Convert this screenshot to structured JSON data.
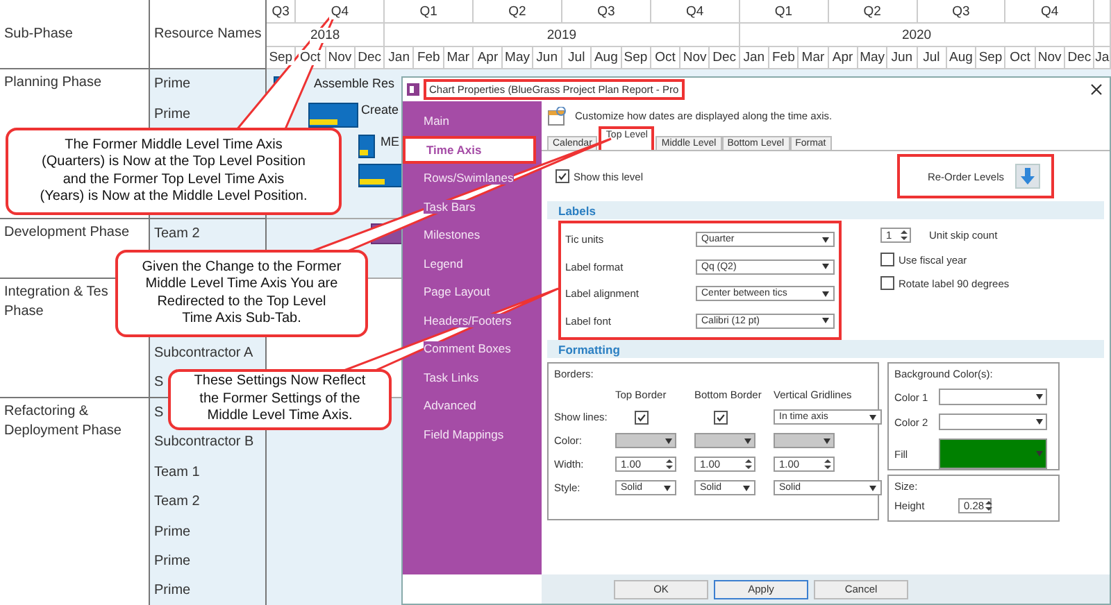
{
  "gantt": {
    "columns": [
      "Sub-Phase",
      "Resource Names"
    ],
    "quarters": [
      "Q3",
      "Q4",
      "Q1",
      "Q2",
      "Q3",
      "Q4",
      "Q1",
      "Q2",
      "Q3",
      "Q4"
    ],
    "years": [
      "2018",
      "2019",
      "2020"
    ],
    "months": [
      "Sep",
      "Oct",
      "Nov",
      "Dec",
      "Jan",
      "Feb",
      "Mar",
      "Apr",
      "May",
      "Jun",
      "Jul",
      "Aug",
      "Sep",
      "Oct",
      "Nov",
      "Dec",
      "Jan",
      "Feb",
      "Mar",
      "Apr",
      "May",
      "Jun",
      "Jul",
      "Aug",
      "Sep",
      "Oct",
      "Nov",
      "Dec",
      "Ja"
    ],
    "phases": [
      {
        "name": [
          "Planning Phase"
        ],
        "shaded": true,
        "resources": [
          "Prime",
          "Prime"
        ],
        "bars": [
          {
            "kind": "task",
            "label": "Assemble Res"
          },
          {
            "kind": "task",
            "label": "Create"
          },
          {
            "kind": "task",
            "label": "ME"
          },
          {
            "kind": "task"
          }
        ]
      },
      {
        "name": [
          "Development Phase"
        ],
        "shaded": true,
        "resources": [
          "Team 2"
        ],
        "bars": [
          {
            "kind": "summary"
          }
        ]
      },
      {
        "name": [
          "Integration & Tes",
          "Phase"
        ],
        "shaded": false,
        "resources": [
          "Subcontractor A",
          "S"
        ]
      },
      {
        "name": [
          "Refactoring &",
          "Deployment Phase"
        ],
        "shaded": true,
        "resources": [
          "S",
          "Subcontractor B",
          "Team 1",
          "Team 2",
          "Prime",
          "Prime",
          "Prime"
        ]
      }
    ]
  },
  "dialog": {
    "title": "Chart Properties (BlueGrass Project Plan Report - Pro",
    "title_highlighted": true,
    "nav": [
      {
        "label": "Main",
        "selected": false
      },
      {
        "label": "Time Axis",
        "selected": true
      },
      {
        "label": "Rows/Swimlanes",
        "selected": false
      },
      {
        "label": "Task Bars",
        "selected": false
      },
      {
        "label": "Milestones",
        "selected": false
      },
      {
        "label": "Legend",
        "selected": false
      },
      {
        "label": "Page Layout",
        "selected": false
      },
      {
        "label": "Headers/Footers",
        "selected": false
      },
      {
        "label": "Comment Boxes",
        "selected": false
      },
      {
        "label": "Task Links",
        "selected": false
      },
      {
        "label": "Advanced",
        "selected": false
      },
      {
        "label": "Field Mappings",
        "selected": false
      }
    ],
    "description": "Customize how dates are displayed along the time axis.",
    "tabs": [
      {
        "label": "Calendar",
        "selected": false,
        "highlighted": false
      },
      {
        "label": "Top Level",
        "selected": true,
        "highlighted": true
      },
      {
        "label": "Middle Level",
        "selected": false,
        "highlighted": false
      },
      {
        "label": "Bottom Level",
        "selected": false,
        "highlighted": false
      },
      {
        "label": "Format",
        "selected": false,
        "highlighted": false
      }
    ],
    "show_level": {
      "label": "Show this level",
      "checked": true
    },
    "reorder": {
      "label": "Re-Order Levels",
      "highlighted": true
    },
    "labels": {
      "title": "Labels",
      "highlighted": true,
      "fields": [
        {
          "label": "Tic units",
          "value": "Quarter"
        },
        {
          "label": "Label format",
          "value": "Qq (Q2)"
        },
        {
          "label": "Label alignment",
          "value": "Center between tics"
        },
        {
          "label": "Label font",
          "value": "Calibri (12 pt)"
        }
      ]
    },
    "unit_skip": {
      "value": "1",
      "label": "Unit skip count"
    },
    "options": [
      {
        "label": "Use fiscal year",
        "checked": false
      },
      {
        "label": "Rotate label 90 degrees",
        "checked": false
      }
    ],
    "formatting": {
      "title": "Formatting",
      "borders_title": "Borders:",
      "columns": [
        "Top Border",
        "Bottom Border",
        "Vertical Gridlines"
      ],
      "rows": [
        {
          "label": "Show lines:",
          "cells": [
            {
              "kind": "checkbox",
              "checked": true
            },
            {
              "kind": "checkbox",
              "checked": true
            },
            {
              "kind": "dropdown",
              "value": "In time axis"
            }
          ]
        },
        {
          "label": "Color:",
          "cells": [
            {
              "kind": "color"
            },
            {
              "kind": "color"
            },
            {
              "kind": "color"
            }
          ]
        },
        {
          "label": "Width:",
          "cells": [
            {
              "kind": "spinner",
              "value": "1.00"
            },
            {
              "kind": "spinner",
              "value": "1.00"
            },
            {
              "kind": "spinner",
              "value": "1.00"
            }
          ]
        },
        {
          "label": "Style:",
          "cells": [
            {
              "kind": "dropdown",
              "value": "Solid"
            },
            {
              "kind": "dropdown",
              "value": "Solid"
            },
            {
              "kind": "dropdown",
              "value": "Solid"
            }
          ]
        }
      ]
    },
    "background": {
      "title": "Background Color(s):",
      "items": [
        {
          "label": "Color 1"
        },
        {
          "label": "Color 2"
        },
        {
          "label": "Fill",
          "color": "#008000"
        }
      ]
    },
    "size": {
      "title": "Size:",
      "label": "Height",
      "value": "0.28"
    },
    "buttons": [
      {
        "label": "OK",
        "focused": false
      },
      {
        "label": "Apply",
        "focused": true
      },
      {
        "label": "Cancel",
        "focused": false
      }
    ]
  },
  "callouts": [
    {
      "text": "The Former Middle Level Time Axis\n(Quarters) is Now at the Top Level Position\nand the Former Top Level Time Axis\n(Years) is Now at the Middle Level Position."
    },
    {
      "text": "Given the Change to the Former\nMiddle Level Time Axis You are\nRedirected to the Top Level\nTime Axis Sub-Tab."
    },
    {
      "text": "These Settings Now Reflect\nthe Former Settings of the\nMiddle Level Time Axis."
    }
  ]
}
